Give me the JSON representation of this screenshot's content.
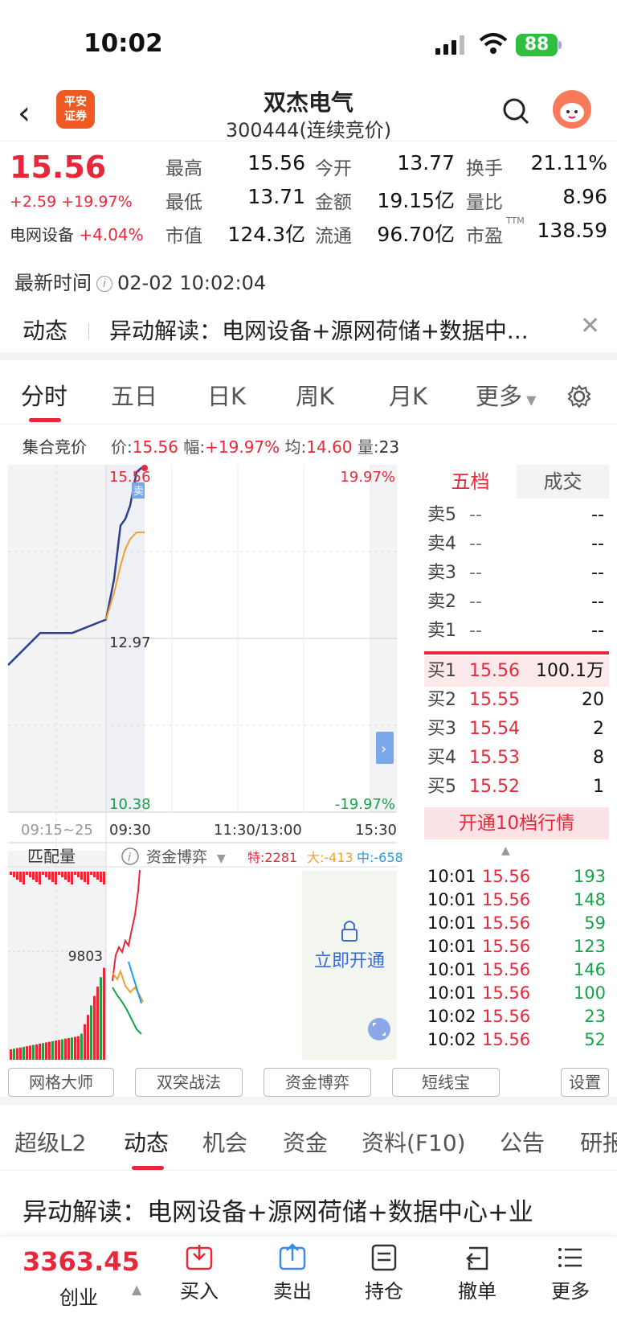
{
  "status_bar": {
    "time": "10:02",
    "battery": "88"
  },
  "header": {
    "broker_logo_line1": "平安",
    "broker_logo_line2": "证券",
    "title": "双杰电气",
    "subtitle": "300444(连续竞价)"
  },
  "quote": {
    "price": "15.56",
    "change": "+2.59 +19.97%",
    "sector_name": "电网设备",
    "sector_change": "+4.04%",
    "stats": [
      {
        "label": "最高",
        "value": "15.56",
        "color": "red"
      },
      {
        "label": "今开",
        "value": "13.77",
        "color": "red"
      },
      {
        "label": "换手",
        "value": "21.11%",
        "color": "black"
      },
      {
        "label": "最低",
        "value": "13.71",
        "color": "red"
      },
      {
        "label": "金额",
        "value": "19.15亿",
        "color": "black"
      },
      {
        "label": "量比",
        "value": "8.96",
        "color": "black"
      },
      {
        "label": "市值",
        "value": "124.3亿",
        "color": "black"
      },
      {
        "label": "流通",
        "value": "96.70亿",
        "color": "black"
      },
      {
        "label": "市盈",
        "value": "138.59",
        "color": "black"
      }
    ],
    "pe_suffix": "TTM"
  },
  "update": {
    "label": "最新时间",
    "value": "02-02 10:02:04"
  },
  "dynamics": {
    "tag": "动态",
    "text": "异动解读：电网设备+源网荷储+数据中..."
  },
  "chart_tabs": [
    "分时",
    "五日",
    "日K",
    "周K",
    "月K",
    "更多"
  ],
  "auction": {
    "label": "集合竞价",
    "price_label": "价:",
    "price": "15.56",
    "amp_label": "幅:",
    "amp": "+19.97%",
    "avg_label": "均:",
    "avg": "14.60",
    "vol_label": "量:",
    "vol": "23"
  },
  "chart": {
    "price_top": "15.56",
    "price_mid": "12.97",
    "price_bottom": "10.38",
    "pct_top": "19.97%",
    "pct_bottom": "-19.97%",
    "time_start": "09:15~25",
    "time_open": "09:30",
    "time_mid": "11:30/13:00",
    "time_close": "15:30",
    "sell_marker": "卖",
    "volume_label": "匹配量",
    "volume_value": "9803",
    "fund_label": "资金博弈",
    "fund_special": "特:2281",
    "fund_large": "大:-413",
    "fund_medium": "中:-658",
    "unlock_label": "立即开通",
    "colors": {
      "price_line": "#2b3f8f",
      "avg_line": "#f0a030",
      "up": "#e8283a",
      "down": "#16a34a"
    }
  },
  "chart_data": {
    "type": "line",
    "x": [
      "09:15",
      "09:20",
      "09:25",
      "09:30",
      "09:35",
      "09:40",
      "09:45",
      "09:50",
      "09:55",
      "10:00",
      "10:02"
    ],
    "series": [
      {
        "values": [
          12.62,
          13.1,
          13.1,
          13.3,
          13.9,
          14.7,
          14.8,
          15.0,
          15.5,
          15.56,
          15.56
        ]
      },
      {
        "values": [
          null,
          null,
          null,
          13.3,
          13.7,
          14.1,
          14.35,
          14.5,
          14.6,
          14.6,
          14.6
        ]
      }
    ],
    "ylim": [
      10.38,
      15.56
    ]
  },
  "orderbook": {
    "tab_depth": "五档",
    "tab_trades": "成交",
    "asks": [
      {
        "label": "卖5",
        "price": "--",
        "vol": "--"
      },
      {
        "label": "卖4",
        "price": "--",
        "vol": "--"
      },
      {
        "label": "卖3",
        "price": "--",
        "vol": "--"
      },
      {
        "label": "卖2",
        "price": "--",
        "vol": "--"
      },
      {
        "label": "卖1",
        "price": "--",
        "vol": "--"
      }
    ],
    "bids": [
      {
        "label": "买1",
        "price": "15.56",
        "vol": "100.1万"
      },
      {
        "label": "买2",
        "price": "15.55",
        "vol": "20"
      },
      {
        "label": "买3",
        "price": "15.54",
        "vol": "2"
      },
      {
        "label": "买4",
        "price": "15.53",
        "vol": "8"
      },
      {
        "label": "买5",
        "price": "15.52",
        "vol": "1"
      }
    ],
    "upgrade": "开通10档行情",
    "trades": [
      {
        "time": "10:01",
        "price": "15.56",
        "vol": "193"
      },
      {
        "time": "10:01",
        "price": "15.56",
        "vol": "148"
      },
      {
        "time": "10:01",
        "price": "15.56",
        "vol": "59"
      },
      {
        "time": "10:01",
        "price": "15.56",
        "vol": "123"
      },
      {
        "time": "10:01",
        "price": "15.56",
        "vol": "146"
      },
      {
        "time": "10:01",
        "price": "15.56",
        "vol": "100"
      },
      {
        "time": "10:02",
        "price": "15.56",
        "vol": "23"
      },
      {
        "time": "10:02",
        "price": "15.56",
        "vol": "52"
      }
    ]
  },
  "tools": [
    "网格大师",
    "双突战法",
    "资金博弈",
    "短线宝",
    "设置"
  ],
  "bottom_tabs": [
    "超级L2",
    "动态",
    "机会",
    "资金",
    "资料(F10)",
    "公告",
    "研报"
  ],
  "feed_text": "异动解读：电网设备+源网荷储+数据中心+业",
  "footer": {
    "index_value": "3363.45",
    "index_name": "创业",
    "buttons": [
      "买入",
      "卖出",
      "持仓",
      "撤单",
      "更多"
    ]
  }
}
